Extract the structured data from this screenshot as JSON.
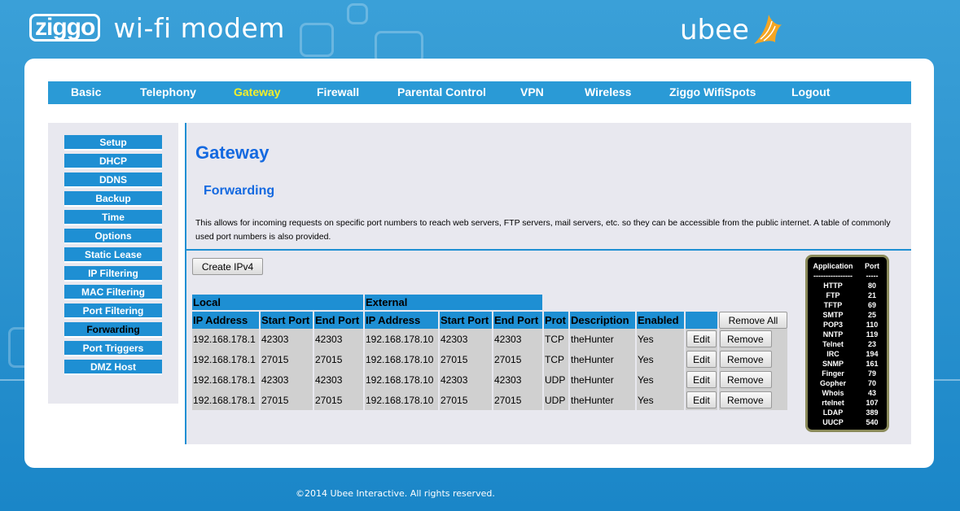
{
  "header": {
    "brand_logo": "ziggo",
    "brand_title": "wi-fi modem",
    "partner_logo": "ubee"
  },
  "nav": [
    {
      "label": "Basic",
      "active": false
    },
    {
      "label": "Telephony",
      "active": false
    },
    {
      "label": "Gateway",
      "active": true
    },
    {
      "label": "Firewall",
      "active": false
    },
    {
      "label": "Parental Control",
      "active": false
    },
    {
      "label": "VPN",
      "active": false
    },
    {
      "label": "Wireless",
      "active": false
    },
    {
      "label": "Ziggo WifiSpots",
      "active": false
    },
    {
      "label": "Logout",
      "active": false
    }
  ],
  "sidebar": [
    {
      "label": "Setup",
      "active": false
    },
    {
      "label": "DHCP",
      "active": false
    },
    {
      "label": "DDNS",
      "active": false
    },
    {
      "label": "Backup",
      "active": false
    },
    {
      "label": "Time",
      "active": false
    },
    {
      "label": "Options",
      "active": false
    },
    {
      "label": "Static Lease",
      "active": false
    },
    {
      "label": "IP Filtering",
      "active": false
    },
    {
      "label": "MAC Filtering",
      "active": false
    },
    {
      "label": "Port Filtering",
      "active": false
    },
    {
      "label": "Forwarding",
      "active": true
    },
    {
      "label": "Port Triggers",
      "active": false
    },
    {
      "label": "DMZ Host",
      "active": false
    }
  ],
  "page": {
    "title": "Gateway",
    "subtitle": "Forwarding",
    "description": "This allows for incoming requests on specific port numbers to reach web servers, FTP servers, mail servers, etc. so they can be accessible from the public internet. A table of commonly used port numbers is also provided.",
    "create_button": "Create IPv4"
  },
  "table": {
    "group_local": "Local",
    "group_external": "External",
    "headers": [
      "IP Address",
      "Start Port",
      "End Port",
      "IP Address",
      "Start Port",
      "End Port",
      "Prot",
      "Description",
      "Enabled"
    ],
    "remove_all_label": "Remove All",
    "edit_label": "Edit",
    "remove_label": "Remove",
    "rows": [
      [
        "192.168.178.1",
        "42303",
        "42303",
        "192.168.178.10",
        "42303",
        "42303",
        "TCP",
        "theHunter",
        "Yes"
      ],
      [
        "192.168.178.1",
        "27015",
        "27015",
        "192.168.178.10",
        "27015",
        "27015",
        "TCP",
        "theHunter",
        "Yes"
      ],
      [
        "192.168.178.1",
        "42303",
        "42303",
        "192.168.178.10",
        "42303",
        "42303",
        "UDP",
        "theHunter",
        "Yes"
      ],
      [
        "192.168.178.1",
        "27015",
        "27015",
        "192.168.178.10",
        "27015",
        "27015",
        "UDP",
        "theHunter",
        "Yes"
      ]
    ]
  },
  "port_reference": {
    "header_app": "Application",
    "header_port": "Port",
    "sep_app": "----------------",
    "sep_port": "-----",
    "rows": [
      [
        "HTTP",
        "80"
      ],
      [
        "FTP",
        "21"
      ],
      [
        "TFTP",
        "69"
      ],
      [
        "SMTP",
        "25"
      ],
      [
        "POP3",
        "110"
      ],
      [
        "NNTP",
        "119"
      ],
      [
        "Telnet",
        "23"
      ],
      [
        "IRC",
        "194"
      ],
      [
        "SNMP",
        "161"
      ],
      [
        "Finger",
        "79"
      ],
      [
        "Gopher",
        "70"
      ],
      [
        "Whois",
        "43"
      ],
      [
        "rtelnet",
        "107"
      ],
      [
        "LDAP",
        "389"
      ],
      [
        "UUCP",
        "540"
      ]
    ]
  },
  "footer": "©2014 Ubee Interactive. All rights reserved.",
  "colors": {
    "accent": "#1e8fd3",
    "active_nav": "#f4ef2a",
    "heading": "#1469e0"
  }
}
